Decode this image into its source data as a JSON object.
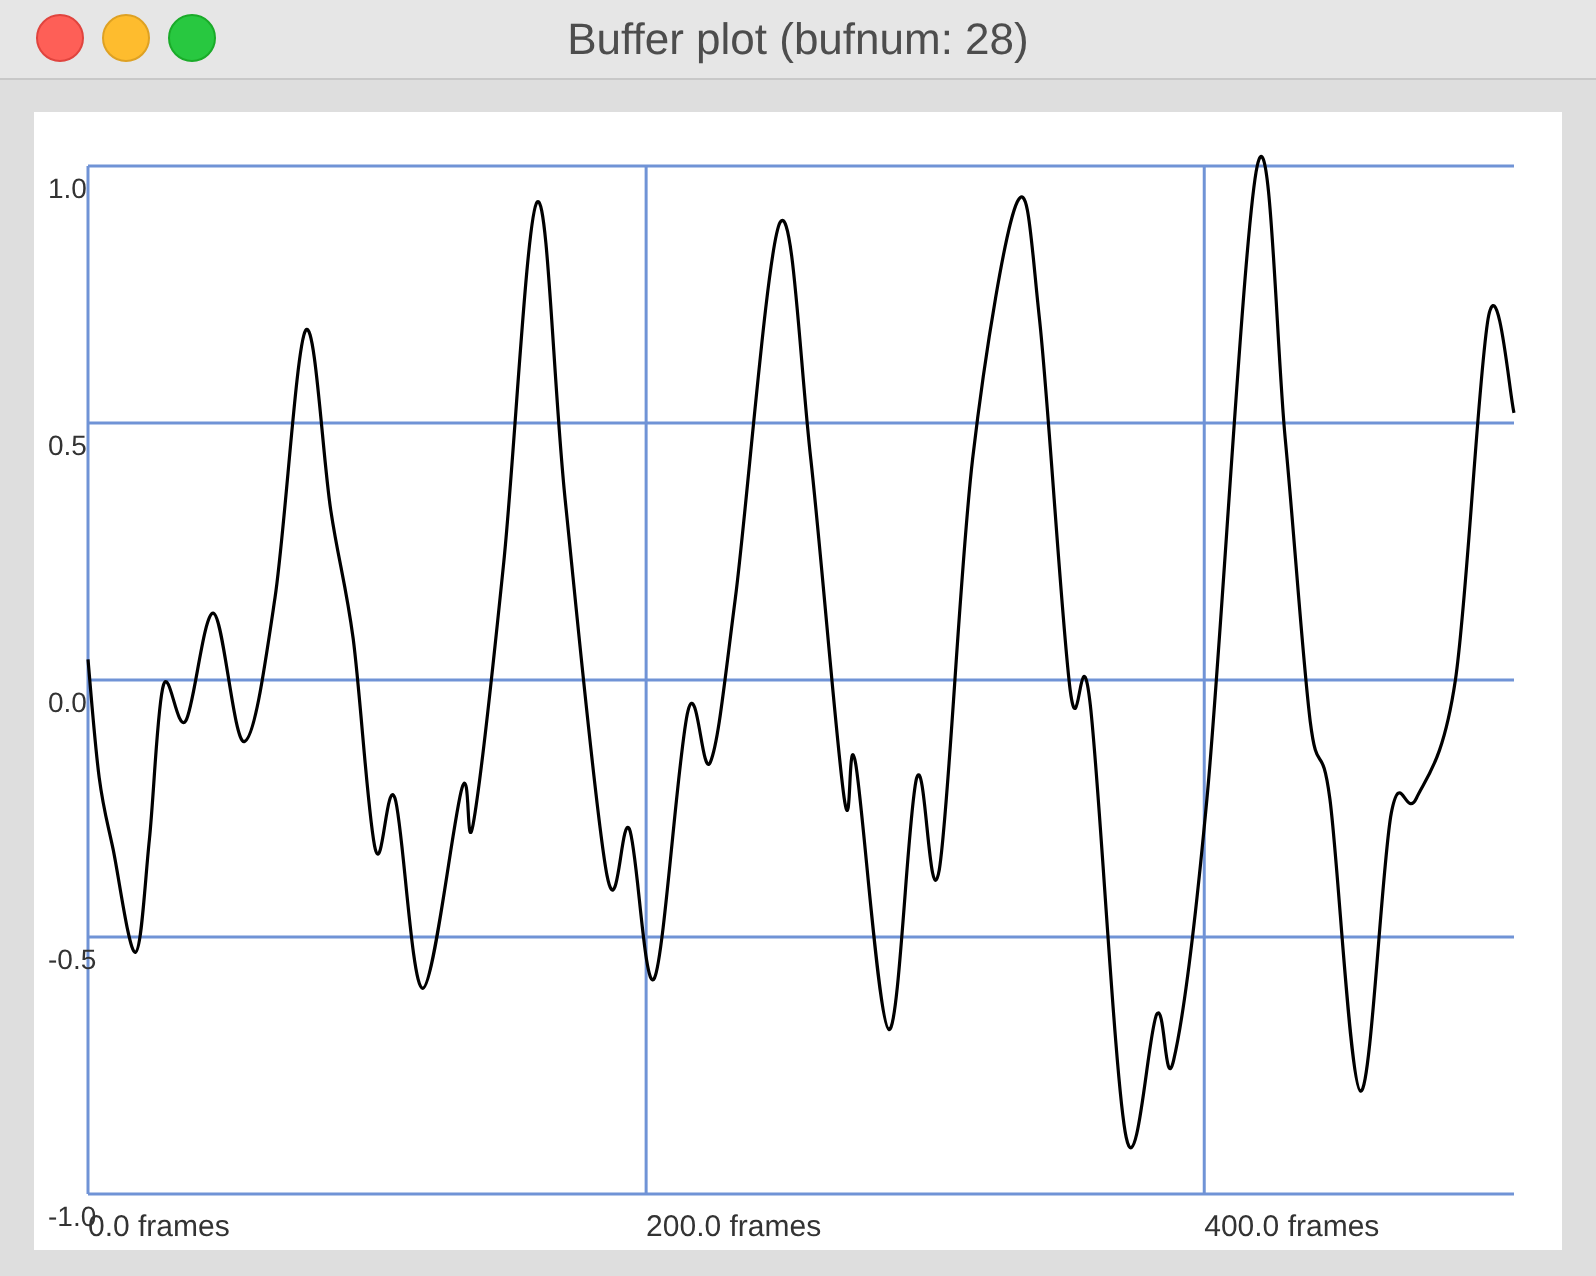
{
  "window": {
    "title": "Buffer plot (bufnum: 28)"
  },
  "plot": {
    "y_ticks": [
      "1.0",
      "0.5",
      "0.0",
      "-0.5",
      "-1.0"
    ],
    "x_ticks": [
      "0.0 frames",
      "200.0 frames",
      "400.0 frames"
    ]
  }
}
